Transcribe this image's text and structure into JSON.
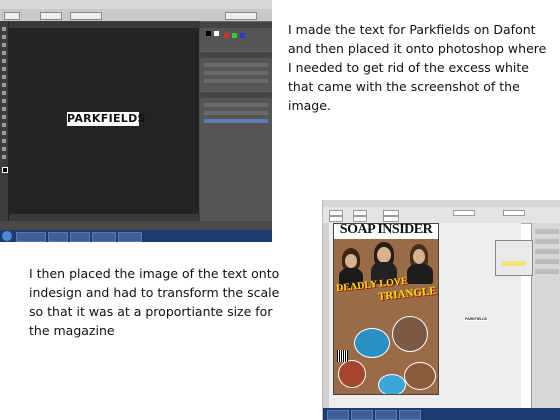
{
  "captions": {
    "first": "I made the text for Parkfields on Dafont and then placed it onto photoshop where I needed to get rid of the excess white that came with the screenshot of the image.",
    "second": "I then placed the image of the text onto indesign and had to transform the scale so that it was at a proportiante size for the magazine"
  },
  "photoshop_screenshot": {
    "canvas_text": "PARKFIELDS"
  },
  "indesign_screenshot": {
    "cover": {
      "masthead": "SOAP INSIDER",
      "headline_line1": "DEADLY LOVE",
      "headline_line2": "TRIANGLE"
    }
  },
  "colors": {
    "photoshop_canvas": "#232323",
    "headline_yellow": "#f2e20a",
    "taskbar_blue": "#1d3c6e"
  }
}
